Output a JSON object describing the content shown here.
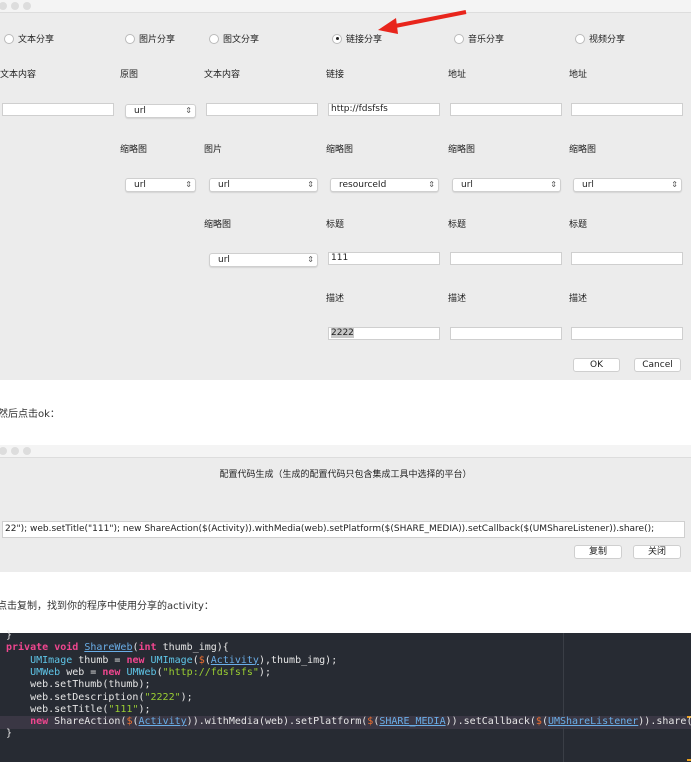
{
  "share_dialog": {
    "columns": [
      {
        "radio": "文本分享",
        "checked": false,
        "fields": [
          {
            "label": "文本内容",
            "type": "input",
            "value": ""
          }
        ]
      },
      {
        "radio": "图片分享",
        "checked": false,
        "fields": [
          {
            "label": "原图",
            "type": "select",
            "value": "url"
          },
          {
            "label": "缩略图",
            "type": "select",
            "value": "url"
          }
        ]
      },
      {
        "radio": "图文分享",
        "checked": false,
        "fields": [
          {
            "label": "文本内容",
            "type": "input",
            "value": ""
          },
          {
            "label": "图片",
            "type": "select",
            "value": "url"
          },
          {
            "label": "缩略图",
            "type": "select",
            "value": "url"
          }
        ]
      },
      {
        "radio": "链接分享",
        "checked": true,
        "fields": [
          {
            "label": "链接",
            "type": "input",
            "value": "http://fdsfsfs"
          },
          {
            "label": "缩略图",
            "type": "select",
            "value": "resourceId"
          },
          {
            "label": "标题",
            "type": "input",
            "value": "111"
          },
          {
            "label": "描述",
            "type": "input",
            "value": "2222",
            "selected": true
          }
        ]
      },
      {
        "radio": "音乐分享",
        "checked": false,
        "fields": [
          {
            "label": "地址",
            "type": "input",
            "value": ""
          },
          {
            "label": "缩略图",
            "type": "select",
            "value": "url"
          },
          {
            "label": "标题",
            "type": "input",
            "value": ""
          },
          {
            "label": "描述",
            "type": "input",
            "value": ""
          }
        ]
      },
      {
        "radio": "视频分享",
        "checked": false,
        "fields": [
          {
            "label": "地址",
            "type": "input",
            "value": ""
          },
          {
            "label": "缩略图",
            "type": "select",
            "value": "url"
          },
          {
            "label": "标题",
            "type": "input",
            "value": ""
          },
          {
            "label": "描述",
            "type": "input",
            "value": ""
          }
        ]
      }
    ],
    "ok_label": "OK",
    "cancel_label": "Cancel"
  },
  "annotation_arrow_color": "#e8251c",
  "text1": "然后点击ok：",
  "code_dialog": {
    "title": "配置代码生成（生成的配置代码只包含集成工具中选择的平台）",
    "code_value": "22\");       web.setTitle(\"111\");        new ShareAction($(Activity)).withMedia(web).setPlatform($(SHARE_MEDIA)).setCallback($(UMShareListener)).share();",
    "copy_label": "复制",
    "close_label": "关闭"
  },
  "text2": "点击复制，找到你的程序中使用分享的activity：",
  "code_lines": [
    "}",
    "private void ShareWeb(int thumb_img){",
    "    UMImage thumb = new UMImage($(Activity),thumb_img);",
    "    UMWeb web = new UMWeb(\"http://fdsfsfs\");",
    "    web.setThumb(thumb);",
    "    web.setDescription(\"2222\");",
    "    web.setTitle(\"111\");",
    "    new ShareAction($(Activity)).withMedia(web).setPlatform($(SHARE_MEDIA)).setCallback($(UMShareListener)).share();",
    "}"
  ]
}
